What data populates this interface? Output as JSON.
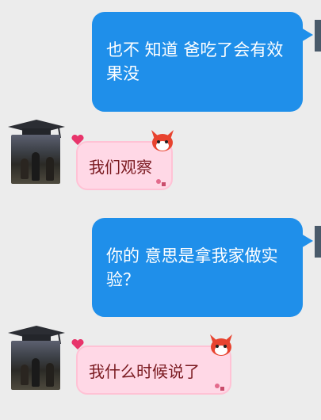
{
  "conversation": {
    "messages": [
      {
        "sender": "me",
        "text": "也不 知道 爸吃了会有效果没"
      },
      {
        "sender": "them",
        "text": "我们观察"
      },
      {
        "sender": "me",
        "text": "你的 意思是拿我家做实验？"
      },
      {
        "sender": "them",
        "text": "我什么时候说了"
      }
    ]
  },
  "colors": {
    "outgoing_bubble": "#1f8fea",
    "incoming_bubble": "#ffd8e6",
    "incoming_text": "#7a1a20",
    "background": "#ececec"
  },
  "icons": {
    "contact_avatar": "avatar-graduation-cap-photo",
    "bubble_sticker": "fox-icon",
    "bubble_decor": "heart-icon"
  }
}
